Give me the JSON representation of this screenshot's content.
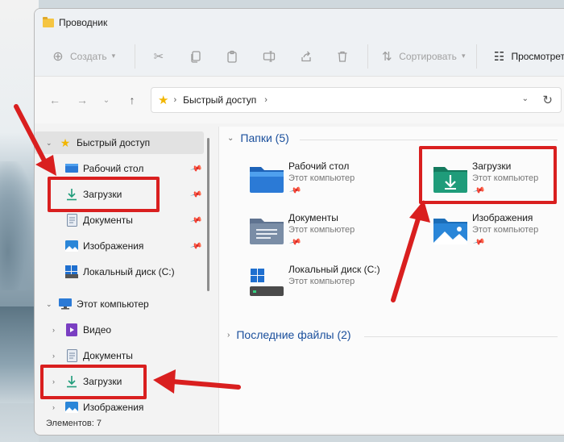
{
  "window": {
    "title": "Проводник"
  },
  "toolbar": {
    "new_label": "Создать",
    "sort_label": "Сортировать",
    "view_label": "Просмотрет"
  },
  "address": {
    "crumb": "Быстрый доступ"
  },
  "nav": {
    "items": [
      {
        "label": "Быстрый доступ",
        "icon": "star-icon",
        "pinned": false
      },
      {
        "label": "Рабочий стол",
        "icon": "desktop-icon",
        "pinned": true
      },
      {
        "label": "Загрузки",
        "icon": "download-icon",
        "pinned": true
      },
      {
        "label": "Документы",
        "icon": "documents-icon",
        "pinned": true
      },
      {
        "label": "Изображения",
        "icon": "pictures-icon",
        "pinned": true
      },
      {
        "label": "Локальный диск (C:)",
        "icon": "drive-icon",
        "pinned": false
      },
      {
        "label": "Этот компьютер",
        "icon": "computer-icon",
        "pinned": false
      },
      {
        "label": "Видео",
        "icon": "video-icon",
        "pinned": false
      },
      {
        "label": "Документы",
        "icon": "documents-icon",
        "pinned": false
      },
      {
        "label": "Загрузки",
        "icon": "download-icon",
        "pinned": false
      },
      {
        "label": "Изображения",
        "icon": "pictures-icon",
        "pinned": false
      }
    ]
  },
  "status": {
    "text": "Элементов: 7"
  },
  "content": {
    "folders_header": "Папки (5)",
    "recent_header": "Последние файлы (2)",
    "folders": [
      {
        "name": "Рабочий стол",
        "location": "Этот компьютер",
        "icon": "desktop-folder-icon",
        "color": "#2b7ad6"
      },
      {
        "name": "Загрузки",
        "location": "Этот компьютер",
        "icon": "downloads-folder-icon",
        "color": "#1f9c7a"
      },
      {
        "name": "Документы",
        "location": "Этот компьютер",
        "icon": "documents-folder-icon",
        "color": "#7a8da6"
      },
      {
        "name": "Изображения",
        "location": "Этот компьютер",
        "icon": "pictures-folder-icon",
        "color": "#2a86d8"
      },
      {
        "name": "Локальный диск (C:)",
        "location": "Этот компьютер",
        "icon": "drive-icon",
        "color": "#555555"
      }
    ]
  },
  "colors": {
    "accent": "#1a4f9c",
    "highlight": "#d91f1f"
  }
}
